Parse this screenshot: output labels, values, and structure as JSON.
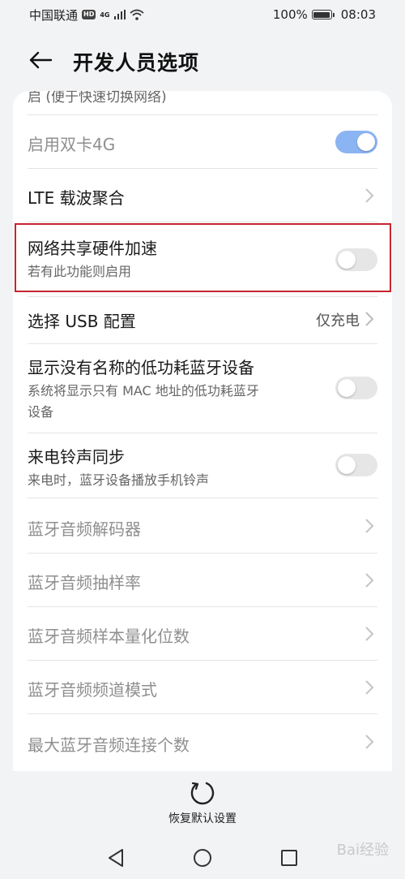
{
  "status_bar": {
    "carrier": "中国联通",
    "hd_badge": "HD",
    "network_type": "4G",
    "battery": "100%",
    "time": "08:03"
  },
  "header": {
    "title": "开发人员选项",
    "back_icon": "arrow-left-icon"
  },
  "settings": {
    "partial_top": "启 (便于快速切换网络)",
    "dual_4g": {
      "title": "启用双卡4G",
      "enabled": false,
      "toggle_on": true
    },
    "lte_ca": {
      "title": "LTE 载波聚合"
    },
    "tether_accel": {
      "title": "网络共享硬件加速",
      "subtitle": "若有此功能则启用",
      "toggle_on": false
    },
    "usb_config": {
      "title": "选择 USB 配置",
      "value": "仅充电"
    },
    "ble_unnamed": {
      "title": "显示没有名称的低功耗蓝牙设备",
      "subtitle_line1": "系统将显示只有 MAC 地址的低功耗蓝牙",
      "subtitle_line2": "设备",
      "toggle_on": false
    },
    "ringtone_sync": {
      "title": "来电铃声同步",
      "subtitle": "来电时，蓝牙设备播放手机铃声",
      "toggle_on": false
    },
    "bt_codec": {
      "title": "蓝牙音频解码器"
    },
    "bt_sample_rate": {
      "title": "蓝牙音频抽样率"
    },
    "bt_bits": {
      "title": "蓝牙音频样本量化位数"
    },
    "bt_channel": {
      "title": "蓝牙音频频道模式"
    },
    "bt_max_conn": {
      "title": "最大蓝牙音频连接个数"
    }
  },
  "reset": {
    "label": "恢复默认设置"
  },
  "highlight_color": "#c7242f",
  "accent_toggle_color": "#8bb4f2",
  "watermark": "Bai经验"
}
